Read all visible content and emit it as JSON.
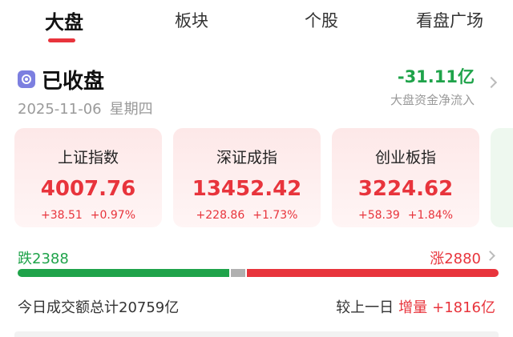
{
  "tabs": [
    {
      "label": "大盘",
      "active": true
    },
    {
      "label": "板块",
      "active": false
    },
    {
      "label": "个股",
      "active": false
    },
    {
      "label": "看盘广场",
      "active": false
    }
  ],
  "market": {
    "status": "已收盘",
    "date": "2025-11-06",
    "weekday": "星期四",
    "net_flow_value": "-31.11亿",
    "net_flow_label": "大盘资金净流入"
  },
  "indices": [
    {
      "name": "上证指数",
      "value": "4007.76",
      "change": "+38.51",
      "pct": "+0.97%"
    },
    {
      "name": "深证成指",
      "value": "13452.42",
      "change": "+228.86",
      "pct": "+1.73%"
    },
    {
      "name": "创业板指",
      "value": "3224.62",
      "change": "+58.39",
      "pct": "+1.84%"
    }
  ],
  "breadth": {
    "down_label": "跌",
    "down_count": "2388",
    "up_label": "涨",
    "up_count": "2880",
    "down_fraction": 0.44,
    "flat_fraction": 0.03,
    "up_fraction": 0.53
  },
  "turnover": {
    "label": "今日成交额总计20759亿",
    "compare_prefix": "较上一日",
    "change_label": "增量",
    "change_value": "+1816亿"
  },
  "colors": {
    "up": "#e8343c",
    "down": "#1fa34a",
    "flat": "#b0b0b0",
    "status_icon": "#7c7fe0"
  }
}
